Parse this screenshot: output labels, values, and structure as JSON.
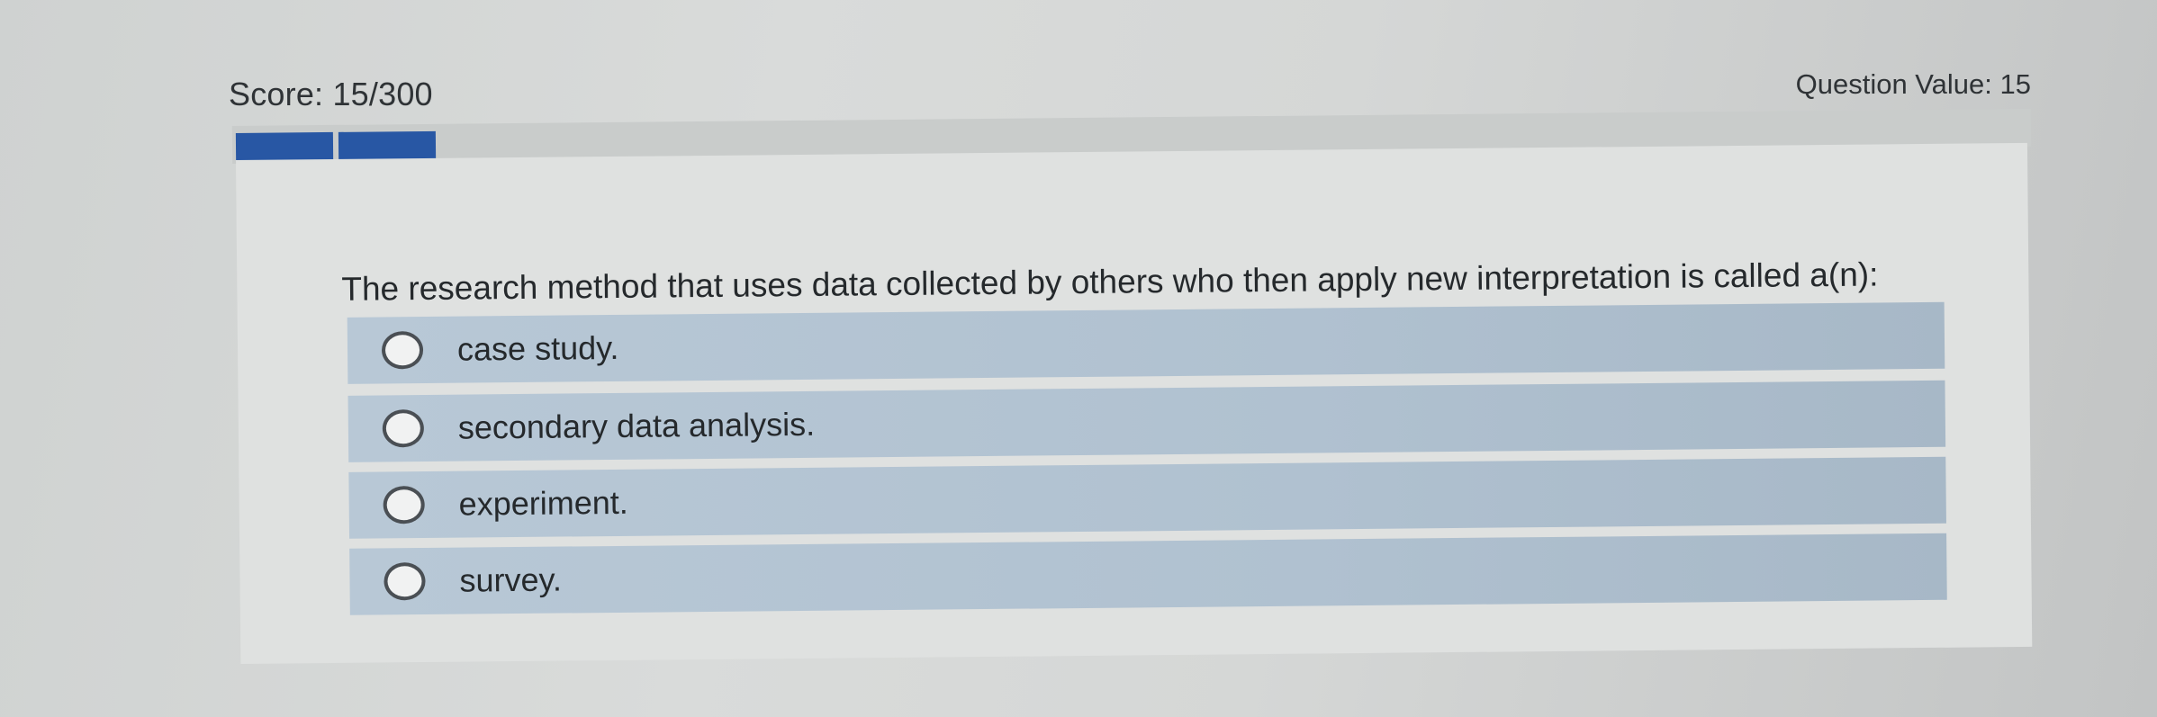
{
  "header": {
    "score": "Score: 15/300",
    "question_value": "Question Value: 15"
  },
  "progress": {
    "filled_segments": 2,
    "accent_color": "#2857a4"
  },
  "question": {
    "text": "The research method that uses data collected by others who then apply new interpretation is called a(n):",
    "options": [
      {
        "label": "case study.",
        "selected": false
      },
      {
        "label": "secondary data analysis.",
        "selected": false
      },
      {
        "label": "experiment.",
        "selected": false
      },
      {
        "label": "survey.",
        "selected": false
      }
    ]
  },
  "icons": {
    "radio": "radio-button-icon"
  }
}
